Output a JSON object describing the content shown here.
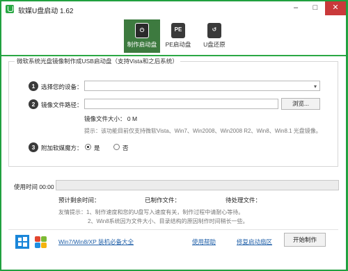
{
  "window": {
    "title": "软媒U盘启动 1.62",
    "min": "–",
    "max": "□",
    "close": "✕"
  },
  "tabs": [
    {
      "label": "制作启动盘",
      "icon": "power-usb-icon",
      "glyph": "⏻",
      "active": true
    },
    {
      "label": "PE启动盘",
      "icon": "pe-usb-icon",
      "glyph": "PE",
      "active": false
    },
    {
      "label": "U盘还原",
      "icon": "restore-usb-icon",
      "glyph": "↺",
      "active": false
    }
  ],
  "group": {
    "title": "微软系统光盘镜像制作成USB启动盘（支持Vista和之后系统）"
  },
  "steps": {
    "device": {
      "num": "1",
      "label": "选择您的设备：",
      "value": ""
    },
    "image": {
      "num": "2",
      "label": "镜像文件路径：",
      "value": "",
      "browse": "浏览..."
    },
    "size": "镜像文件大小：  0 M",
    "hint": "提示：该功能目前仅支持微软Vista、Win7、Win2008、Win2008 R2、Win8、Win8.1 光盘镜像。",
    "wizard": {
      "num": "3",
      "label": "附加软媒魔方：",
      "yes": "是",
      "no": "否",
      "selected": "yes"
    }
  },
  "progress": {
    "time_label": "使用时间 00:00",
    "percent": 0,
    "remaining": "预计剩余时间：",
    "copied": "已制作文件：",
    "pending": "待处理文件："
  },
  "tips": {
    "line1": "友情提示：1、制作速度和您的U盘写入速度有关，制作过程中请耐心等待。",
    "line2": "2、Win8系统因为文件大小、目录结构的原因制作时间稍长一些。"
  },
  "footer": {
    "win_link": "Win7/Win8/XP 装机必备大全",
    "help": "使用帮助",
    "repair": "修复启动扇区",
    "start": "开始制作"
  },
  "colors": {
    "accent": "#2aa844",
    "active_tab": "#3d7a3f",
    "close": "#c9393a"
  }
}
